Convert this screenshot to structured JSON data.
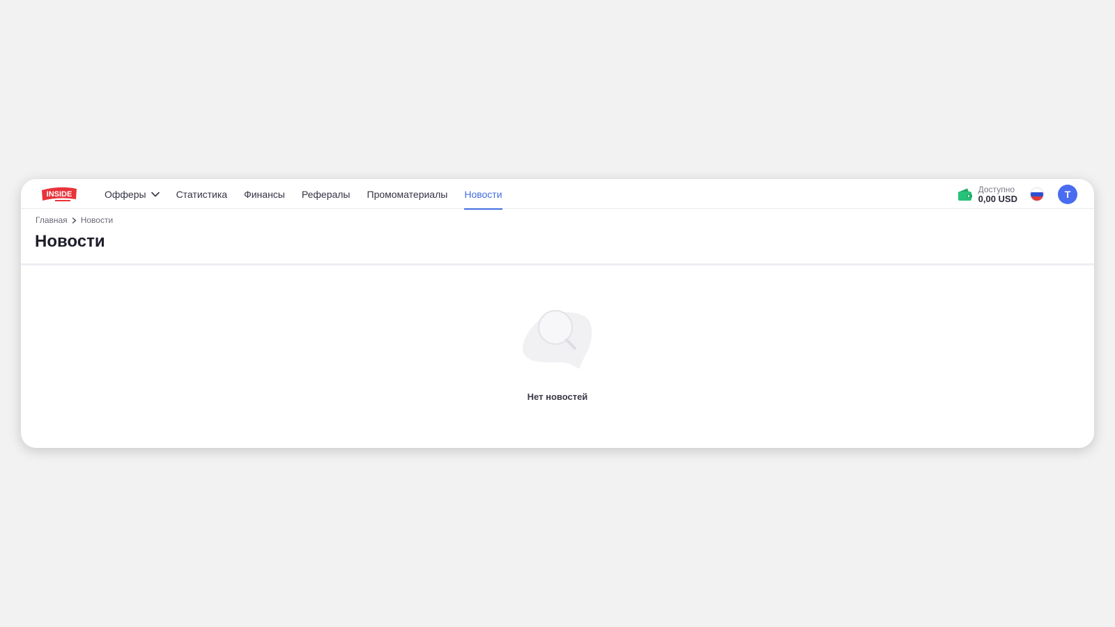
{
  "brand": {
    "logo_text": "INSIDE",
    "logo_color": "#e8333a"
  },
  "nav": {
    "items": [
      {
        "label": "Офферы",
        "dropdown": true
      },
      {
        "label": "Статистика"
      },
      {
        "label": "Финансы"
      },
      {
        "label": "Рефералы"
      },
      {
        "label": "Промоматериалы"
      },
      {
        "label": "Новости",
        "active": true
      }
    ],
    "accent_color": "#3f6de0"
  },
  "account": {
    "balance_label": "Доступно",
    "balance_value": "0,00 USD",
    "wallet_icon": "wallet-icon",
    "wallet_color": "#27c27a",
    "language_flag": "russia-flag-icon",
    "avatar_letter": "T",
    "avatar_color": "#4a6cf0"
  },
  "breadcrumb": {
    "home": "Главная",
    "current": "Новости"
  },
  "page": {
    "title": "Новости"
  },
  "empty_state": {
    "icon": "search-magnifier-icon",
    "message": "Нет новостей"
  }
}
